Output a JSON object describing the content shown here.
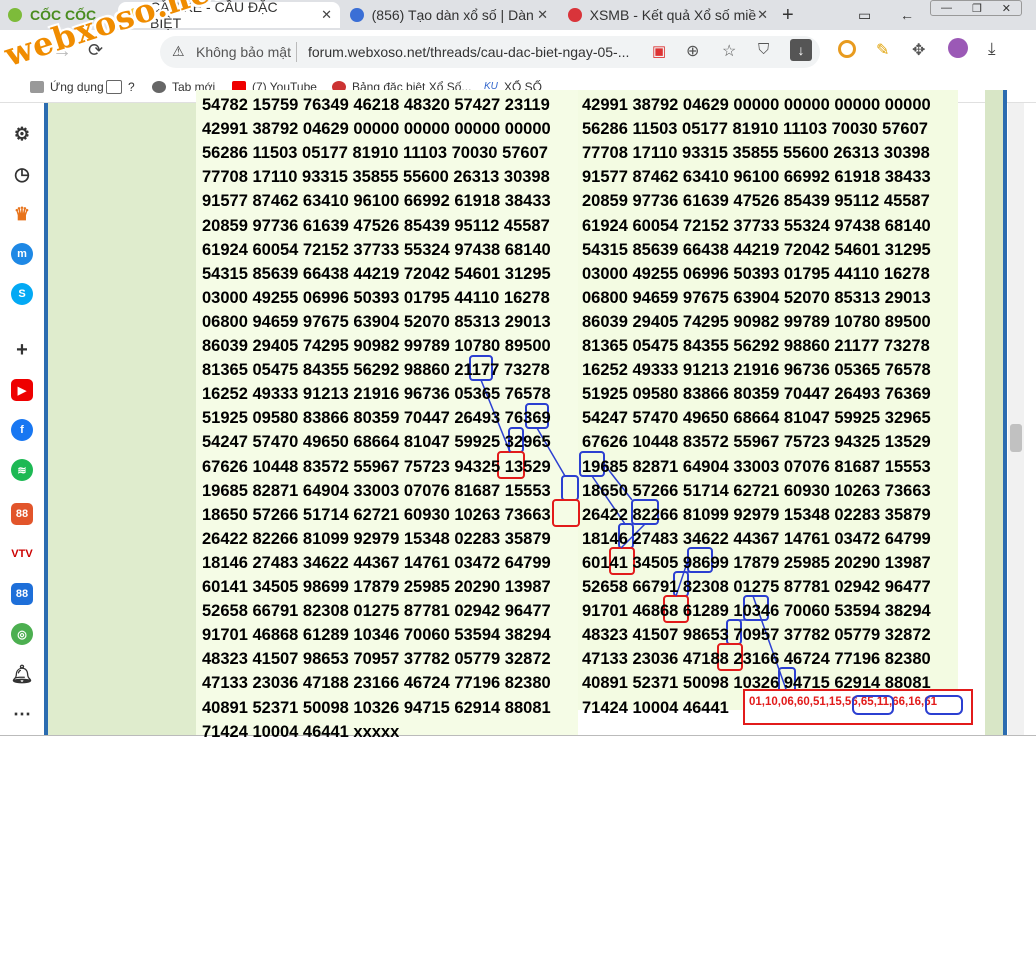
{
  "browser": {
    "app_name": "CỐC CỐC",
    "tabs": [
      {
        "label": "CẦU KẾ - CẦU ĐẶC BIỆT",
        "active": true
      },
      {
        "label": "(856) Tạo dàn xổ số | Dàn"
      },
      {
        "label": "XSMB - Kết quả Xổ số miề"
      }
    ],
    "security_label": "Không bảo mật",
    "url": "forum.webxoso.net/threads/cau-dac-biet-ngay-05-...",
    "bookmarks": [
      "Ứng dụng",
      "?",
      "Tab mới",
      "(7) YouTube",
      "Bảng đặc biệt Xổ Số...",
      "XỔ SỐ"
    ]
  },
  "watermark": "webxoso.net",
  "left_column_lines": [
    "54782 15759 76349 46218 48320 57427 23119",
    "42991 38792 04629 00000 00000 00000 00000",
    "56286 11503 05177 81910 11103 70030 57607",
    "77708 17110 93315 35855 55600 26313 30398",
    "91577 87462 63410 96100 66992 61918 38433",
    "20859 97736 61639 47526 85439 95112 45587",
    "61924 60054 72152 37733 55324 97438 68140",
    "54315 85639 66438 44219 72042 54601 31295",
    "03000 49255 06996 50393 01795 44110 16278",
    "06800 94659 97675 63904 52070 85313 29013",
    "86039 29405 74295 90982 99789 10780 89500",
    "81365 05475 84355 56292 98860 21177 73278",
    "16252 49333 91213 21916 96736 05365 76578",
    "51925 09580 83866 80359 70447 26493 76369",
    "54247 57470 49650 68664 81047 59925 32965",
    "67626 10448 83572 55967 75723 94325 13529",
    "19685 82871 64904 33003 07076 81687 15553",
    "18650 57266 51714 62721 60930 10263 73663",
    "26422 82266 81099 92979 15348 02283 35879",
    "18146 27483 34622 44367 14761 03472 64799",
    "60141 34505 98699 17879 25985 20290 13987",
    "52658 66791 82308 01275 87781 02942 96477",
    "91701 46868 61289 10346 70060 53594 38294",
    "48323 41507 98653 70957 37782 05779 32872",
    "47133 23036 47188 23166 46724 77196 82380",
    "40891 52371 50098 10326 94715 62914 88081",
    "71424 10004 46441 xxxxx"
  ],
  "right_column_lines": [
    "42991 38792 04629 00000 00000 00000 00000",
    "56286 11503 05177 81910 11103 70030 57607",
    "77708 17110 93315 35855 55600 26313 30398",
    "91577 87462 63410 96100 66992 61918 38433",
    "20859 97736 61639 47526 85439 95112 45587",
    "61924 60054 72152 37733 55324 97438 68140",
    "54315 85639 66438 44219 72042 54601 31295",
    "03000 49255 06996 50393 01795 44110 16278",
    "06800 94659 97675 63904 52070 85313 29013",
    "86039 29405 74295 90982 99789 10780 89500",
    "81365 05475 84355 56292 98860 21177 73278",
    "16252 49333 91213 21916 96736 05365 76578",
    "51925 09580 83866 80359 70447 26493 76369",
    "54247 57470 49650 68664 81047 59925 32965",
    "67626 10448 83572 55967 75723 94325 13529",
    "19685 82871 64904 33003 07076 81687 15553",
    "18650 57266 51714 62721 60930 10263 73663",
    "26422 82266 81099 92979 15348 02283 35879",
    "18146 27483 34622 44367 14761 03472 64799",
    "60141 34505 98699 17879 25985 20290 13987",
    "52658 66791 82308 01275 87781 02942 96477",
    "91701 46868 61289 10346 70060 53594 38294",
    "48323 41507 98653 70957 37782 05779 32872",
    "47133 23036 47188 23166 46724 77196 82380",
    "40891 52371 50098 10326 94715 62914 88081",
    "71424 10004 46441"
  ],
  "result_text": "01,10,06,60,51,15,56,65,11,66,16,61",
  "colors": {
    "highlight_blue": "#2b3fd1",
    "highlight_red": "#e21b1b",
    "page_blue": "#2b6cb0"
  }
}
